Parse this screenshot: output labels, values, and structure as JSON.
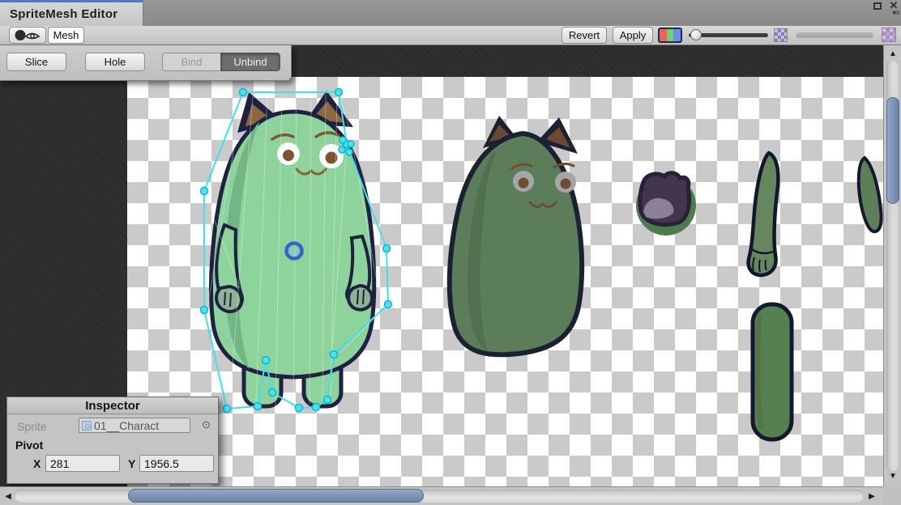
{
  "titlebar": {
    "tab": "SpriteMesh Editor",
    "close_icon": "✕",
    "menu_icon": "▾≡"
  },
  "toolbar": {
    "mesh_tab": "Mesh",
    "revert": "Revert",
    "apply": "Apply"
  },
  "mesh_toolbar": {
    "slice": "Slice",
    "hole": "Hole",
    "bind": "Bind",
    "unbind": "Unbind"
  },
  "inspector": {
    "title": "Inspector",
    "sprite_label": "Sprite",
    "sprite_value": "01__Charact",
    "picker_icon": "⊙",
    "pivot_label": "Pivot",
    "x_label": "X",
    "x_value": "281",
    "y_label": "Y",
    "y_value": "1956.5"
  },
  "scroll_icons": {
    "up": "▲",
    "down": "▼",
    "left": "◀",
    "right": "▶"
  },
  "colors": {
    "tab_accent": "#4d7cc1",
    "scroll_thumb": "#7e95b8",
    "mesh_outline": "#3ee1f0",
    "pivot_ring": "#2f66cc",
    "character_green": "#8ed29c",
    "dimmed_sprite_green": "#5b7d5a",
    "mouth_purple": "#41364e",
    "canvas_dark": "#2d2d2d"
  }
}
